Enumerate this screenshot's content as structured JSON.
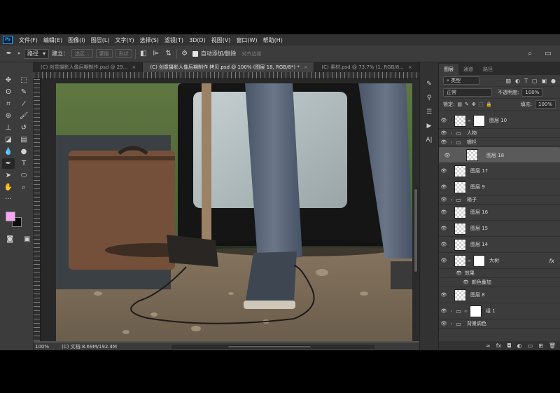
{
  "menu": [
    "文件(F)",
    "编辑(E)",
    "图像(I)",
    "图层(L)",
    "文字(Y)",
    "选择(S)",
    "滤镜(T)",
    "3D(D)",
    "视图(V)",
    "窗口(W)",
    "帮助(H)"
  ],
  "options": {
    "mode": "路径",
    "build_label": "建立：",
    "selection_btn": "选区...",
    "mask_btn": "蒙版",
    "shape_btn": "形状",
    "auto_add_label": "自动添加/删除",
    "align_edges": "对齐边缘"
  },
  "tabs": [
    {
      "label": "(C) 创意摄影人像后期制作.psd @ 29...",
      "active": false
    },
    {
      "label": "(C) 创意摄影人像后期制作 拷贝.psd @ 100% (图层 18, RGB/8*) *",
      "active": true
    },
    {
      "label": "(C) 素材.psd @ 73.7% (1, RGB/8...",
      "active": false
    }
  ],
  "status": {
    "zoom": "100%",
    "doc": "(C) 文档:8.69M/192.4M"
  },
  "panel": {
    "tabs": [
      "图层",
      "通道",
      "路径"
    ],
    "kind_label": "类型",
    "blend_mode": "正常",
    "opacity_label": "不透明度:",
    "opacity_value": "100%",
    "lock_label": "锁定:",
    "fill_label": "填充:",
    "fill_value": "100%"
  },
  "layers": [
    {
      "name": "图层 10",
      "type": "mask"
    },
    {
      "name": "人物",
      "type": "group"
    },
    {
      "name": "栅栏",
      "type": "group"
    },
    {
      "name": "图层 18",
      "type": "pixel",
      "selected": true
    },
    {
      "name": "图层 17",
      "type": "pixel"
    },
    {
      "name": "图层 9",
      "type": "pixel"
    },
    {
      "name": "箱子",
      "type": "group"
    },
    {
      "name": "图层 16",
      "type": "pixel"
    },
    {
      "name": "图层 15",
      "type": "pixel"
    },
    {
      "name": "图层 14",
      "type": "pixel"
    },
    {
      "name": "大树",
      "type": "mask",
      "fx": "fx"
    },
    {
      "name": "效果",
      "type": "effect"
    },
    {
      "name": "颜色叠加",
      "type": "effect-item"
    },
    {
      "name": "图层 8",
      "type": "pixel"
    },
    {
      "name": "组 1",
      "type": "group-mask"
    },
    {
      "name": "背景调色",
      "type": "group"
    }
  ],
  "colors": {
    "foreground": "#f7a6f3",
    "background": "#0d0d0d"
  }
}
